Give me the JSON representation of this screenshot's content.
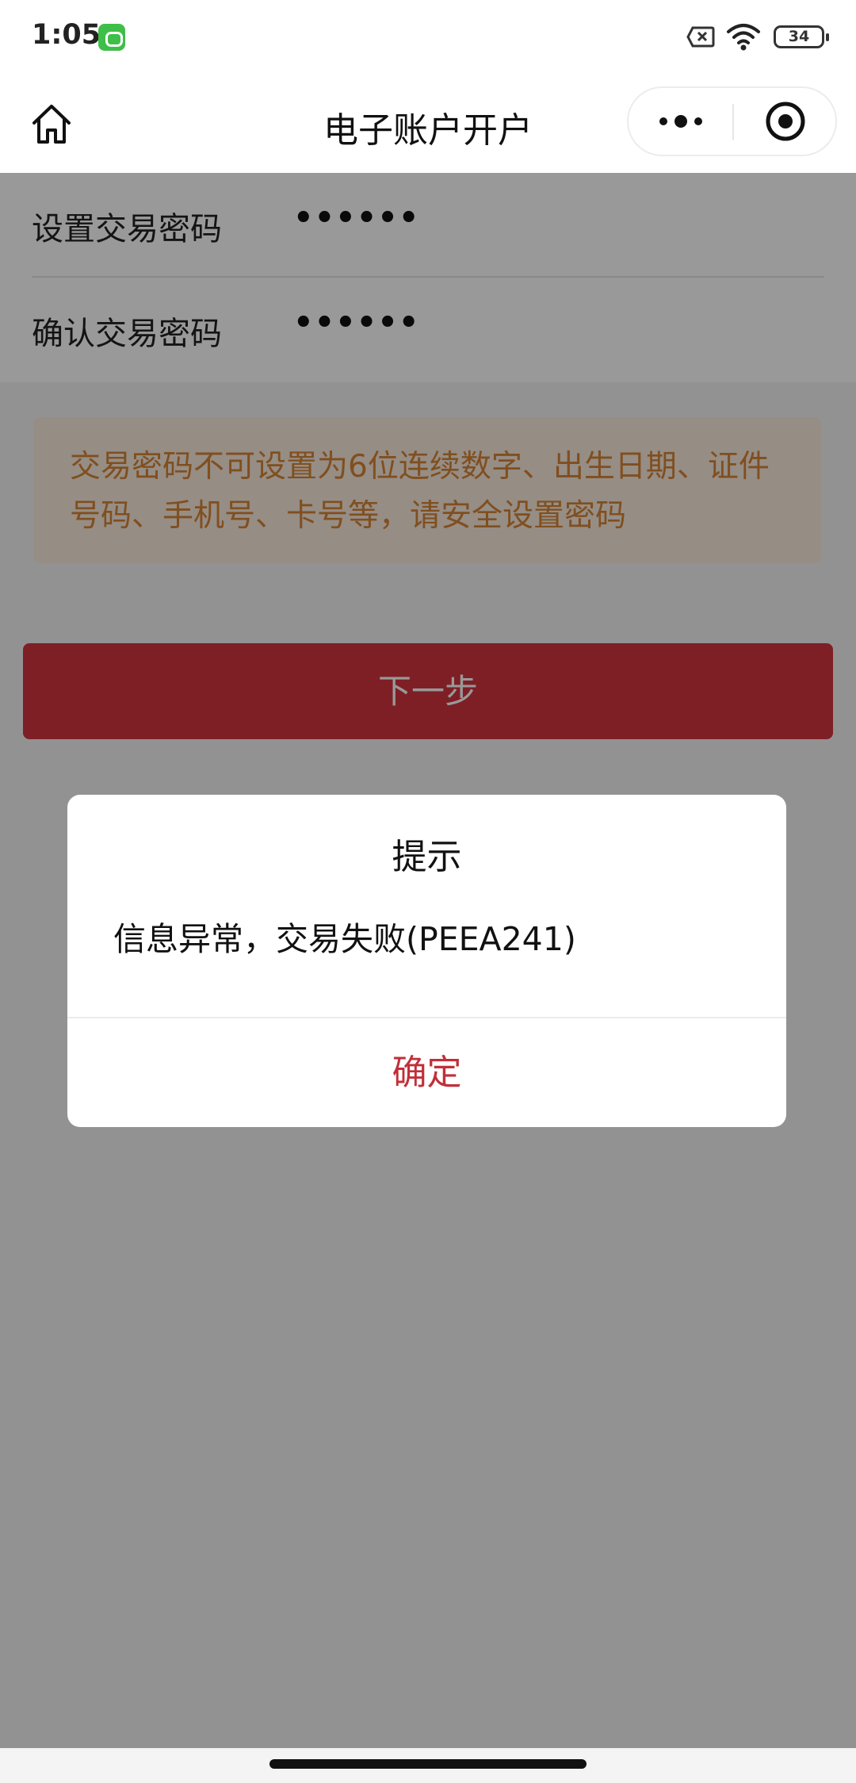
{
  "status_bar": {
    "time": "1:05",
    "battery": "34"
  },
  "nav": {
    "title": "电子账户开户",
    "more_icon": "more-dots-icon",
    "close_icon": "close-miniprogram-icon"
  },
  "form": {
    "set_password": {
      "label": "设置交易密码",
      "value": "••••••"
    },
    "confirm_password": {
      "label": "确认交易密码",
      "value": "••••••"
    }
  },
  "notice": {
    "text": "交易密码不可设置为6位连续数字、出生日期、证件号码、手机号、卡号等，请安全设置密码"
  },
  "next_button": {
    "label": "下一步"
  },
  "dialog": {
    "title": "提示",
    "message": "信息异常，交易失败(PEEA241)",
    "confirm_label": "确定"
  },
  "colors": {
    "accent": "#d3353f",
    "notice_text": "#d68434",
    "notice_bg": "#fbecde",
    "confirm_text": "#c0303a"
  }
}
